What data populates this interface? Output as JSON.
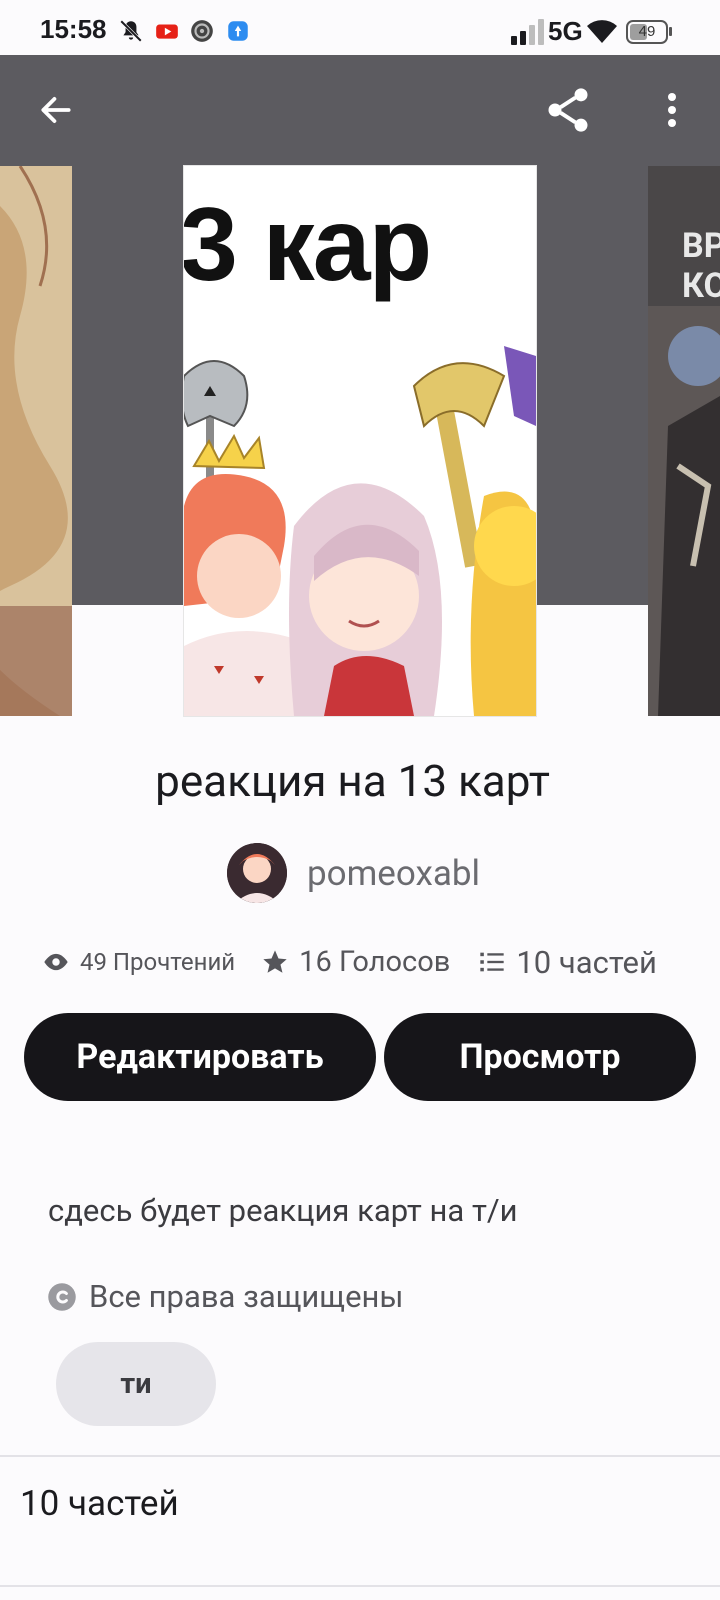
{
  "status_bar": {
    "time": "15:58",
    "network": "5G",
    "battery": "49",
    "icons": [
      "bell-off-icon",
      "youtube-icon",
      "app-icon",
      "notification-app-icon",
      "signal-icon",
      "wifi-icon",
      "battery-icon"
    ]
  },
  "toolbar": {
    "back_icon": "arrow-left-icon",
    "share_icon": "share-icon",
    "more_icon": "more-vertical-icon"
  },
  "cover": {
    "main_title_art": "3 кар",
    "right_art": "ВР\nКО"
  },
  "story": {
    "title": "реакция на 13 карт",
    "author": "pomeoxabl",
    "reads": "49 Прочтений",
    "votes": "16 Голосов",
    "parts": "10 частей",
    "description": "сдесь будет реакция карт на т/и",
    "copyright": "Все права защищены",
    "tags": [
      "ти"
    ]
  },
  "actions": {
    "edit": "Редактировать",
    "view": "Просмотр"
  },
  "parts_section": {
    "heading": "10 частей"
  },
  "colors": {
    "header_bg": "#5c5b60",
    "button_bg": "#161519",
    "tag_bg": "#e6e5ea",
    "page_bg": "#fcfbfd"
  }
}
